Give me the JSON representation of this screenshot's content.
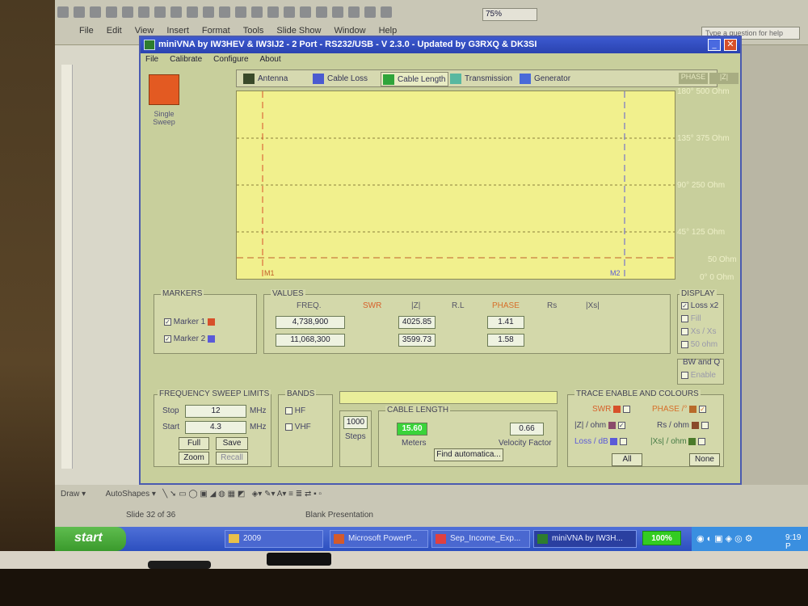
{
  "powerpoint": {
    "menu": [
      "File",
      "Edit",
      "View",
      "Insert",
      "Format",
      "Tools",
      "Slide Show",
      "Window",
      "Help"
    ],
    "zoom": "75%",
    "help_placeholder": "Type a question for help",
    "draw_label": "Draw",
    "autoshapes_label": "AutoShapes",
    "slide_info": "Slide 32 of 36",
    "design": "Blank Presentation"
  },
  "taskbar": {
    "start": "start",
    "items": [
      "2009",
      "Microsoft PowerP...",
      "Sep_Income_Exp...",
      "miniVNA by IW3H..."
    ],
    "battery": "100%",
    "clock": "9:19 P"
  },
  "app": {
    "title": "miniVNA by IW3HEV & IW3IJ2 - 2 Port - RS232/USB - V 2.3.0 - Updated by G3RXQ & DK3SI",
    "menu": [
      "File",
      "Calibrate",
      "Configure",
      "About"
    ],
    "sweep_button": "Single Sweep",
    "tabs": [
      {
        "label": "Antenna",
        "color": "#3a4a2a"
      },
      {
        "label": "Cable Loss",
        "color": "#4a5ad0"
      },
      {
        "label": "Cable Length",
        "color": "#2fa43a"
      },
      {
        "label": "Transmission",
        "color": "#58b8a0"
      },
      {
        "label": "Generator",
        "color": "#4a6ad8"
      }
    ],
    "active_tab": "Cable Length",
    "plot_headers": {
      "phase": "PHASE",
      "z": "|Z|"
    },
    "y_labels": [
      "180° 500 Ohm",
      "135° 375 Ohm",
      "90° 250 Ohm",
      "45° 125 Ohm",
      "50 Ohm",
      "0° 0 Ohm"
    ],
    "marker_labels": [
      "M1",
      "M2"
    ],
    "markers_panel": {
      "title": "MARKERS",
      "items": [
        {
          "label": "Marker 1",
          "checked": true,
          "color": "#d7502a"
        },
        {
          "label": "Marker 2",
          "checked": true,
          "color": "#5a5ad8"
        }
      ]
    },
    "values_panel": {
      "title": "VALUES",
      "headers": [
        "FREQ.",
        "SWR",
        "|Z|",
        "R.L",
        "PHASE",
        "Rs",
        "|Xs|"
      ],
      "rows": [
        {
          "freq": "4,738,900",
          "z": "4025.85",
          "phase": "1.41"
        },
        {
          "freq": "11,068,300",
          "z": "3599.73",
          "phase": "1.58"
        }
      ]
    },
    "display_panel": {
      "title": "DISPLAY",
      "items": [
        {
          "label": "Loss x2",
          "checked": true
        },
        {
          "label": "Fill",
          "checked": false
        },
        {
          "label": "Xs / Xs",
          "checked": false
        },
        {
          "label": "50 ohm",
          "checked": false
        }
      ],
      "bwq_title": "BW and Q",
      "enable_label": "Enable"
    },
    "freq_panel": {
      "title": "FREQUENCY SWEEP LIMITS",
      "stop_label": "Stop",
      "stop_value": "12",
      "start_label": "Start",
      "start_value": "4.3",
      "unit": "MHz",
      "buttons": [
        "Full",
        "Save",
        "Zoom",
        "Recall"
      ]
    },
    "bands_panel": {
      "title": "BANDS",
      "items": [
        "HF",
        "VHF"
      ]
    },
    "steps": {
      "value": "1000",
      "label": "Steps"
    },
    "cable_panel": {
      "title": "CABLE LENGTH",
      "meters_value": "15.60",
      "meters_label": "Meters",
      "vf_value": "0.66",
      "vf_label": "Velocity Factor",
      "find_button": "Find automatica..."
    },
    "trace_panel": {
      "title": "TRACE ENABLE AND COLOURS",
      "items": [
        {
          "label": "SWR",
          "color": "#d7502a",
          "checked": false,
          "label_color": "#d7602a"
        },
        {
          "label": "PHASE /°",
          "color": "#b86a2a",
          "checked": true,
          "label_color": "#d7702a"
        },
        {
          "label": "|Z| / ohm",
          "color": "#8a4a6a",
          "checked": true,
          "label_color": "#445"
        },
        {
          "label": "Rs / ohm",
          "color": "#8a4a2a",
          "checked": false,
          "label_color": "#445"
        },
        {
          "label": "Loss / dB",
          "color": "#5a5ad8",
          "checked": false,
          "label_color": "#5a5ad8"
        },
        {
          "label": "|Xs| / ohm",
          "color": "#4a7a2a",
          "checked": false,
          "label_color": "#447a44"
        }
      ],
      "all_button": "All",
      "none_button": "None"
    }
  }
}
